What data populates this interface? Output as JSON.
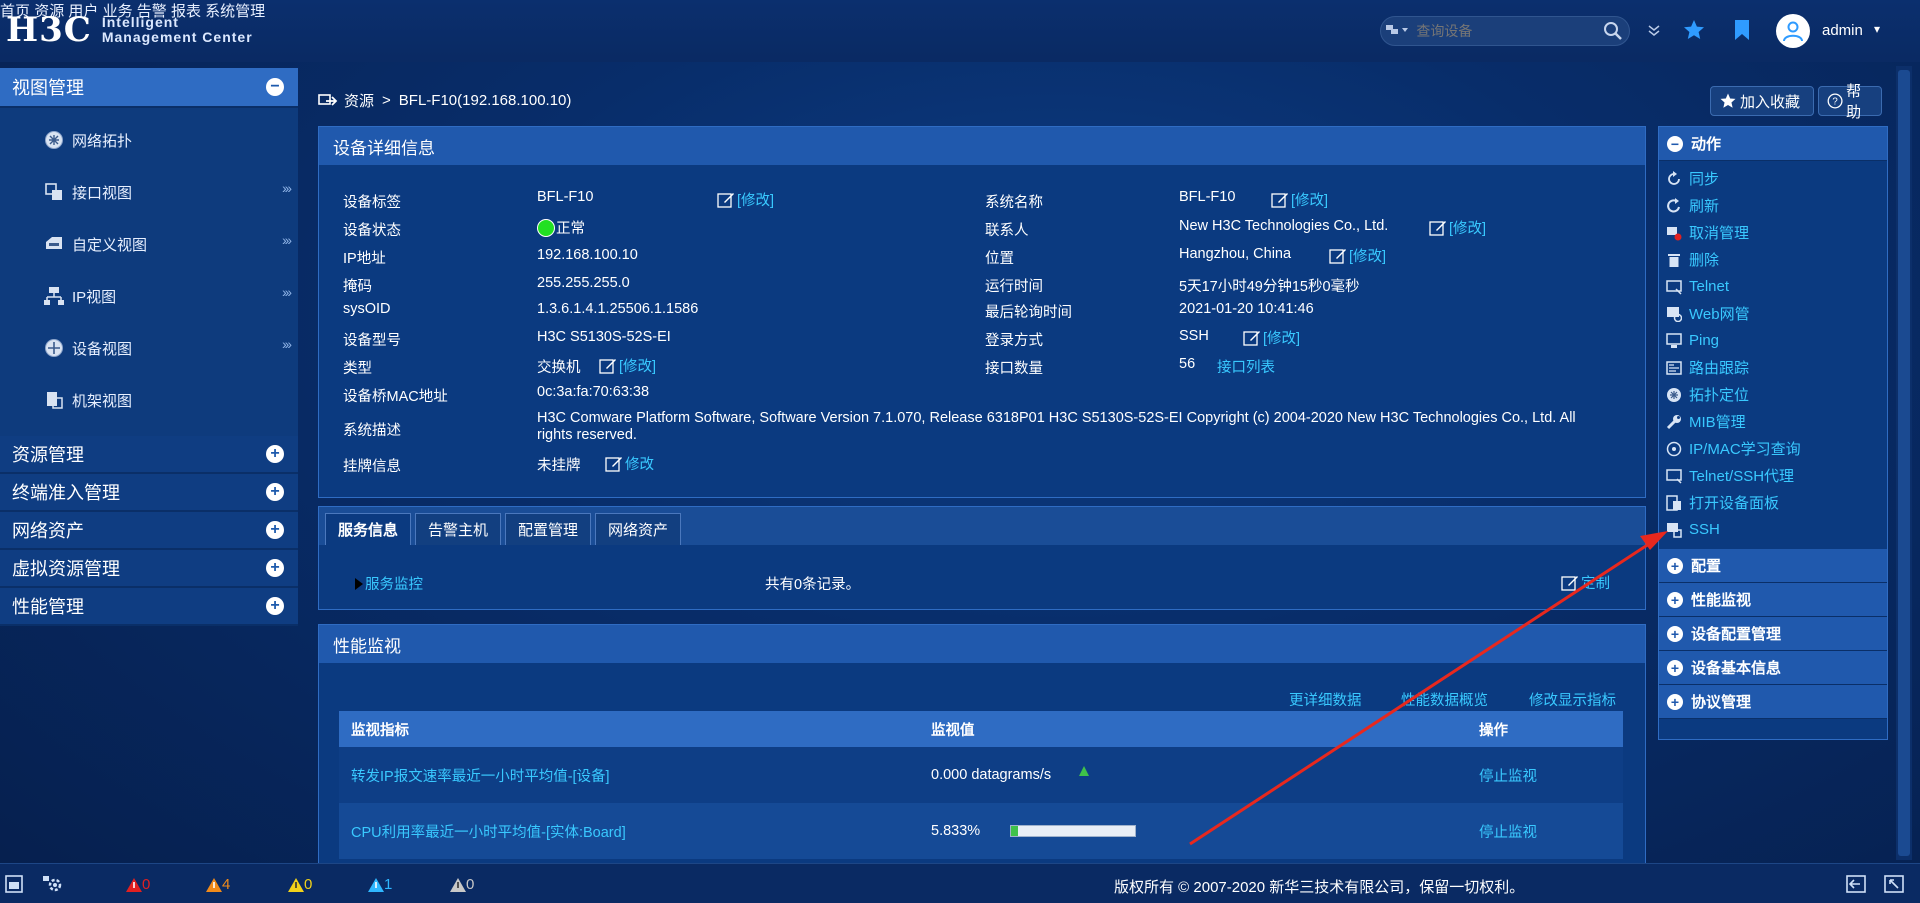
{
  "header": {
    "logo_brand": "H3C",
    "logo_line1": "Intelligent",
    "logo_line2": "Management Center",
    "nav": [
      "首页",
      "资源",
      "用户",
      "业务",
      "告警",
      "报表",
      "系统管理"
    ],
    "search_placeholder": "查询设备",
    "username": "admin"
  },
  "sidebar": {
    "groups": [
      {
        "label": "视图管理",
        "expanded": true,
        "items": [
          {
            "label": "网络拓扑",
            "icon": "topology-icon",
            "arrow": ""
          },
          {
            "label": "接口视图",
            "icon": "interface-view-icon",
            "arrow": "›››"
          },
          {
            "label": "自定义视图",
            "icon": "custom-view-icon",
            "arrow": "›››"
          },
          {
            "label": "IP视图",
            "icon": "ip-view-icon",
            "arrow": "›››"
          },
          {
            "label": "设备视图",
            "icon": "device-view-icon",
            "arrow": "›››"
          },
          {
            "label": "机架视图",
            "icon": "rack-view-icon",
            "arrow": ""
          }
        ]
      },
      {
        "label": "资源管理",
        "expanded": false
      },
      {
        "label": "终端准入管理",
        "expanded": false
      },
      {
        "label": "网络资产",
        "expanded": false
      },
      {
        "label": "虚拟资源管理",
        "expanded": false
      },
      {
        "label": "性能管理",
        "expanded": false
      }
    ]
  },
  "breadcrumb": {
    "root": "资源",
    "separator": ">",
    "current": "BFL-F10(192.168.100.10)"
  },
  "top_buttons": {
    "favorite": "加入收藏",
    "help": "帮助"
  },
  "device_detail": {
    "title": "设备详细信息",
    "edit_label": "[修改]",
    "left": [
      {
        "label": "设备标签",
        "value": "BFL-F10",
        "editable": true
      },
      {
        "label": "设备状态",
        "value": "正常",
        "status": true
      },
      {
        "label": "IP地址",
        "value": "192.168.100.10"
      },
      {
        "label": "掩码",
        "value": "255.255.255.0"
      },
      {
        "label": "sysOID",
        "value": "1.3.6.1.4.1.25506.1.1586"
      },
      {
        "label": "设备型号",
        "value": "H3C S5130S-52S-EI"
      },
      {
        "label": "类型",
        "value": "交换机",
        "editable": true
      },
      {
        "label": "设备桥MAC地址",
        "value": "0c:3a:fa:70:63:38"
      }
    ],
    "right": [
      {
        "label": "系统名称",
        "value": "BFL-F10",
        "editable": true
      },
      {
        "label": "联系人",
        "value": "New H3C Technologies Co., Ltd.",
        "editable": true
      },
      {
        "label": "位置",
        "value": "Hangzhou, China",
        "editable": true
      },
      {
        "label": "运行时间",
        "value": "5天17小时49分钟15秒0毫秒"
      },
      {
        "label": "最后轮询时间",
        "value": "2021-01-20 10:41:46"
      },
      {
        "label": "登录方式",
        "value": "SSH",
        "editable": true
      },
      {
        "label": "接口数量",
        "value": "56",
        "link": "接口列表"
      }
    ],
    "sys_desc_label": "系统描述",
    "sys_desc_line1": "H3C Comware Platform Software, Software Version 7.1.070, Release 6318P01 H3C S5130S-52S-EI Copyright (c) 2004-2020 New H3C Technologies Co., Ltd. All",
    "sys_desc_line2": "rights reserved.",
    "tag_label": "挂牌信息",
    "tag_value": "未挂牌",
    "tag_edit": "修改"
  },
  "tabs": {
    "items": [
      "服务信息",
      "告警主机",
      "配置管理",
      "网络资产"
    ],
    "active": 0,
    "service_monitor_link": "服务监控",
    "record_count_text": "共有0条记录。",
    "customize_label": "定制"
  },
  "performance": {
    "title": "性能监视",
    "links": [
      "更详细数据",
      "性能数据概览",
      "修改显示指标"
    ],
    "columns": [
      "监视指标",
      "监视值",
      "操作"
    ],
    "rows": [
      {
        "metric": "转发IP报文速率最近一小时平均值-[设备]",
        "value": "0.000 datagrams/s",
        "action": "停止监视",
        "bar": null
      },
      {
        "metric": "CPU利用率最近一小时平均值-[实体:Board]",
        "value": "5.833%",
        "action": "停止监视",
        "bar": 0.05833
      }
    ]
  },
  "actions_panel": {
    "sections": [
      {
        "label": "动作",
        "expanded": true,
        "items": [
          {
            "label": "同步",
            "icon": "sync-icon"
          },
          {
            "label": "刷新",
            "icon": "refresh-icon"
          },
          {
            "label": "取消管理",
            "icon": "unmanage-icon"
          },
          {
            "label": "删除",
            "icon": "trash-icon"
          },
          {
            "label": "Telnet",
            "icon": "telnet-icon"
          },
          {
            "label": "Web网管",
            "icon": "web-manage-icon"
          },
          {
            "label": "Ping",
            "icon": "ping-icon"
          },
          {
            "label": "路由跟踪",
            "icon": "traceroute-icon"
          },
          {
            "label": "拓扑定位",
            "icon": "topology-locate-icon"
          },
          {
            "label": "MIB管理",
            "icon": "wrench-icon"
          },
          {
            "label": "IP/MAC学习查询",
            "icon": "ipmac-icon"
          },
          {
            "label": "Telnet/SSH代理",
            "icon": "proxy-icon"
          },
          {
            "label": "打开设备面板",
            "icon": "device-panel-icon"
          },
          {
            "label": "SSH",
            "icon": "ssh-icon"
          }
        ]
      },
      {
        "label": "配置",
        "expanded": false
      },
      {
        "label": "性能监视",
        "expanded": false
      },
      {
        "label": "设备配置管理",
        "expanded": false
      },
      {
        "label": "设备基本信息",
        "expanded": false
      },
      {
        "label": "协议管理",
        "expanded": false
      }
    ]
  },
  "status_bar": {
    "alarms": [
      {
        "count": "0",
        "color": "#e02020"
      },
      {
        "count": "4",
        "color": "#f08a1a"
      },
      {
        "count": "0",
        "color": "#f2d21a"
      },
      {
        "count": "1",
        "color": "#2fb7ff"
      },
      {
        "count": "0",
        "color": "#c8c8c8"
      }
    ],
    "copyright": "版权所有 © 2007-2020 新华三技术有限公司，保留一切权利。"
  },
  "colors": {
    "accent": "#2f6cc3",
    "link": "#39c9ff",
    "status_ok": "#22e022",
    "annotation_arrow": "#e8281e"
  }
}
